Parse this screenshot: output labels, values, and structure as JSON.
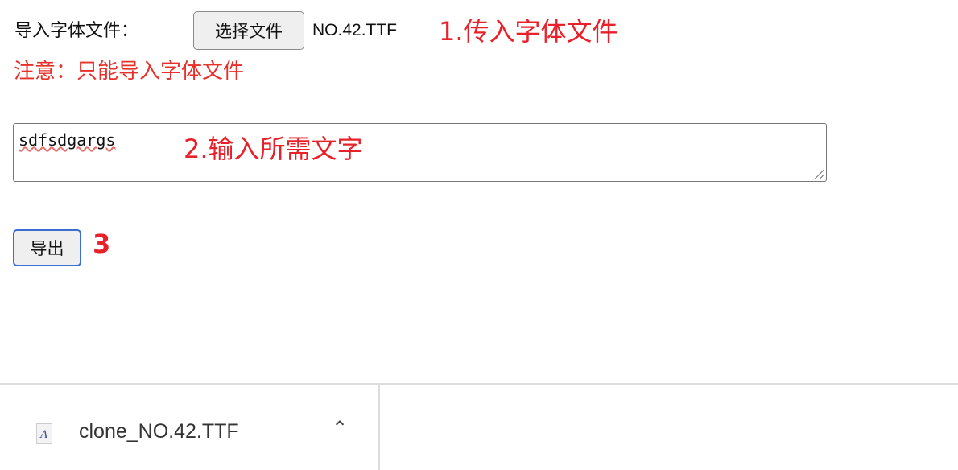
{
  "form": {
    "import_label": "导入字体文件：",
    "choose_button": "选择文件",
    "file_name": "NO.42.TTF",
    "note": "注意：只能导入字体文件",
    "text_value": "sdfsdgargs",
    "export_button": "导出"
  },
  "annotations": {
    "step1": "1.传入字体文件",
    "step2": "2.输入所需文字",
    "step3": "3",
    "color": "#e8202a"
  },
  "download_shelf": {
    "file_name": "clone_NO.42.TTF",
    "file_icon": "font-file-icon",
    "chevron": "^"
  }
}
